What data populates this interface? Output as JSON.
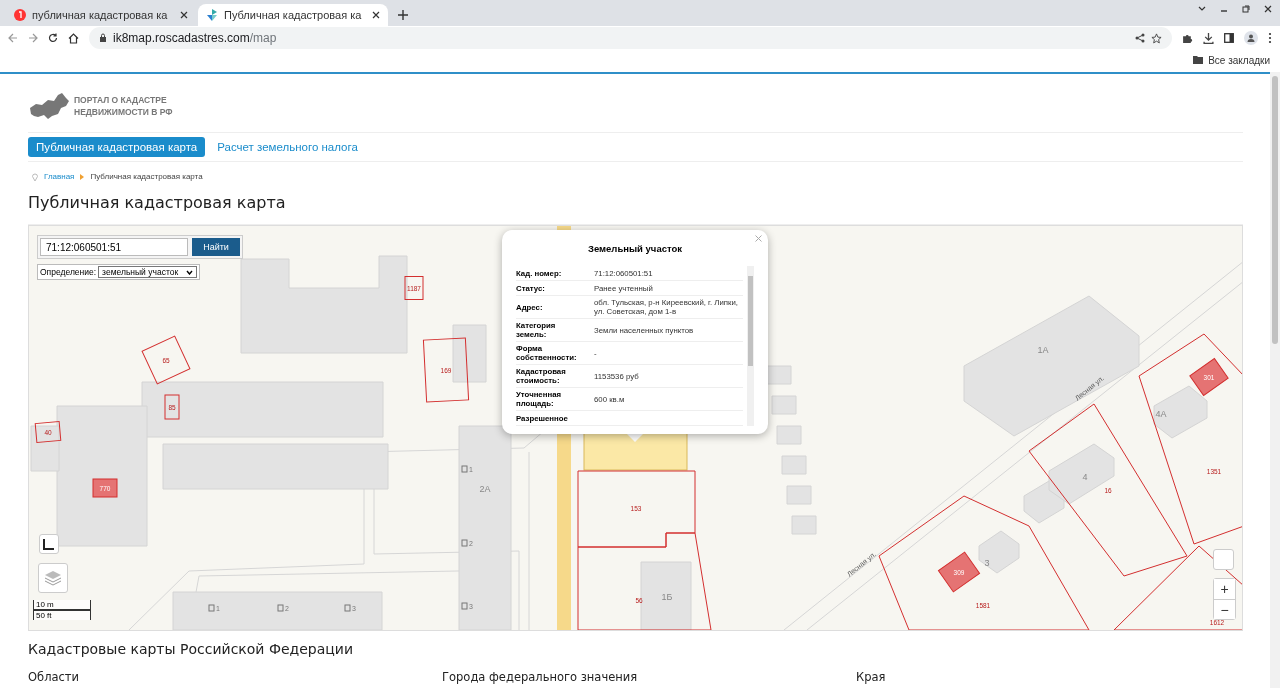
{
  "browser": {
    "tabs": [
      {
        "title": "публичная кадастровая ка",
        "selected": false,
        "kind": "search"
      },
      {
        "title": "Публичная кадастровая ка",
        "selected": true,
        "kind": "site"
      }
    ],
    "url_host": "ik8map.roscadastres.com",
    "url_path": "/map",
    "bookmarks_label": "Все закладки"
  },
  "header": {
    "logo_lines": [
      "ПОРТАЛ О КАДАСТРЕ",
      "НЕДВИЖИМОСТИ В РФ"
    ]
  },
  "nav": [
    {
      "label": "Публичная кадастровая карта",
      "selected": true
    },
    {
      "label": "Расчет земельного налога",
      "selected": false
    }
  ],
  "breadcrumbs": [
    {
      "label": "Главная",
      "kind": "link"
    },
    {
      "label": "Публичная кадастровая карта",
      "kind": "current"
    }
  ],
  "page_title": "Публичная кадастровая карта",
  "map": {
    "search": {
      "value": "71:12:060501:51",
      "button": "Найти"
    },
    "definition": {
      "label": "Определение:",
      "value": "земельный участок"
    },
    "popup": {
      "title": "Земельный участок",
      "rows": [
        {
          "label": "Кад. номер:",
          "value": "71:12:060501:51"
        },
        {
          "label": "Статус:",
          "value": "Ранее учтенный"
        },
        {
          "label": "Адрес:",
          "value": "обл. Тульская, р-н Киреевский, г. Липки, ул. Советская, дом 1-в"
        },
        {
          "label": "Категория земель:",
          "value": "Земли населенных пунктов"
        },
        {
          "label": "Форма собственности:",
          "value": "-"
        },
        {
          "label": "Кадастровая стоимость:",
          "value": "1153536 руб"
        },
        {
          "label": "Уточненная площадь:",
          "value": "600 кв.м"
        },
        {
          "label": "Разрешенное"
        }
      ]
    },
    "parcels": [
      {
        "label": "65",
        "highlighted": false
      },
      {
        "label": "85",
        "highlighted": false
      },
      {
        "label": "40",
        "highlighted": false
      },
      {
        "label": "770",
        "highlighted": true
      },
      {
        "label": "1187",
        "highlighted": false
      },
      {
        "label": "169",
        "highlighted": false
      },
      {
        "label": "153",
        "highlighted": false
      },
      {
        "label": "56",
        "highlighted": false
      },
      {
        "label": "1351",
        "highlighted": false
      },
      {
        "label": "16",
        "highlighted": false
      },
      {
        "label": "1581",
        "highlighted": false
      },
      {
        "label": "1612",
        "highlighted": false
      },
      {
        "label": "301",
        "highlighted": true
      },
      {
        "label": "309",
        "highlighted": true
      }
    ],
    "building_labels": [
      "2А",
      "1А",
      "4А",
      "4",
      "1Б",
      "3"
    ],
    "streets": [
      "Лесная ул.",
      "Лесная ул."
    ],
    "entrances": [
      "1",
      "2",
      "3",
      "1",
      "2",
      "3"
    ],
    "scale": [
      "10 m",
      "50 ft"
    ],
    "zoom": [
      "+",
      "−"
    ]
  },
  "section": {
    "title": "Кадастровые карты Российской Федерации",
    "columns": [
      "Области",
      "Города федерального значения",
      "Края"
    ]
  }
}
